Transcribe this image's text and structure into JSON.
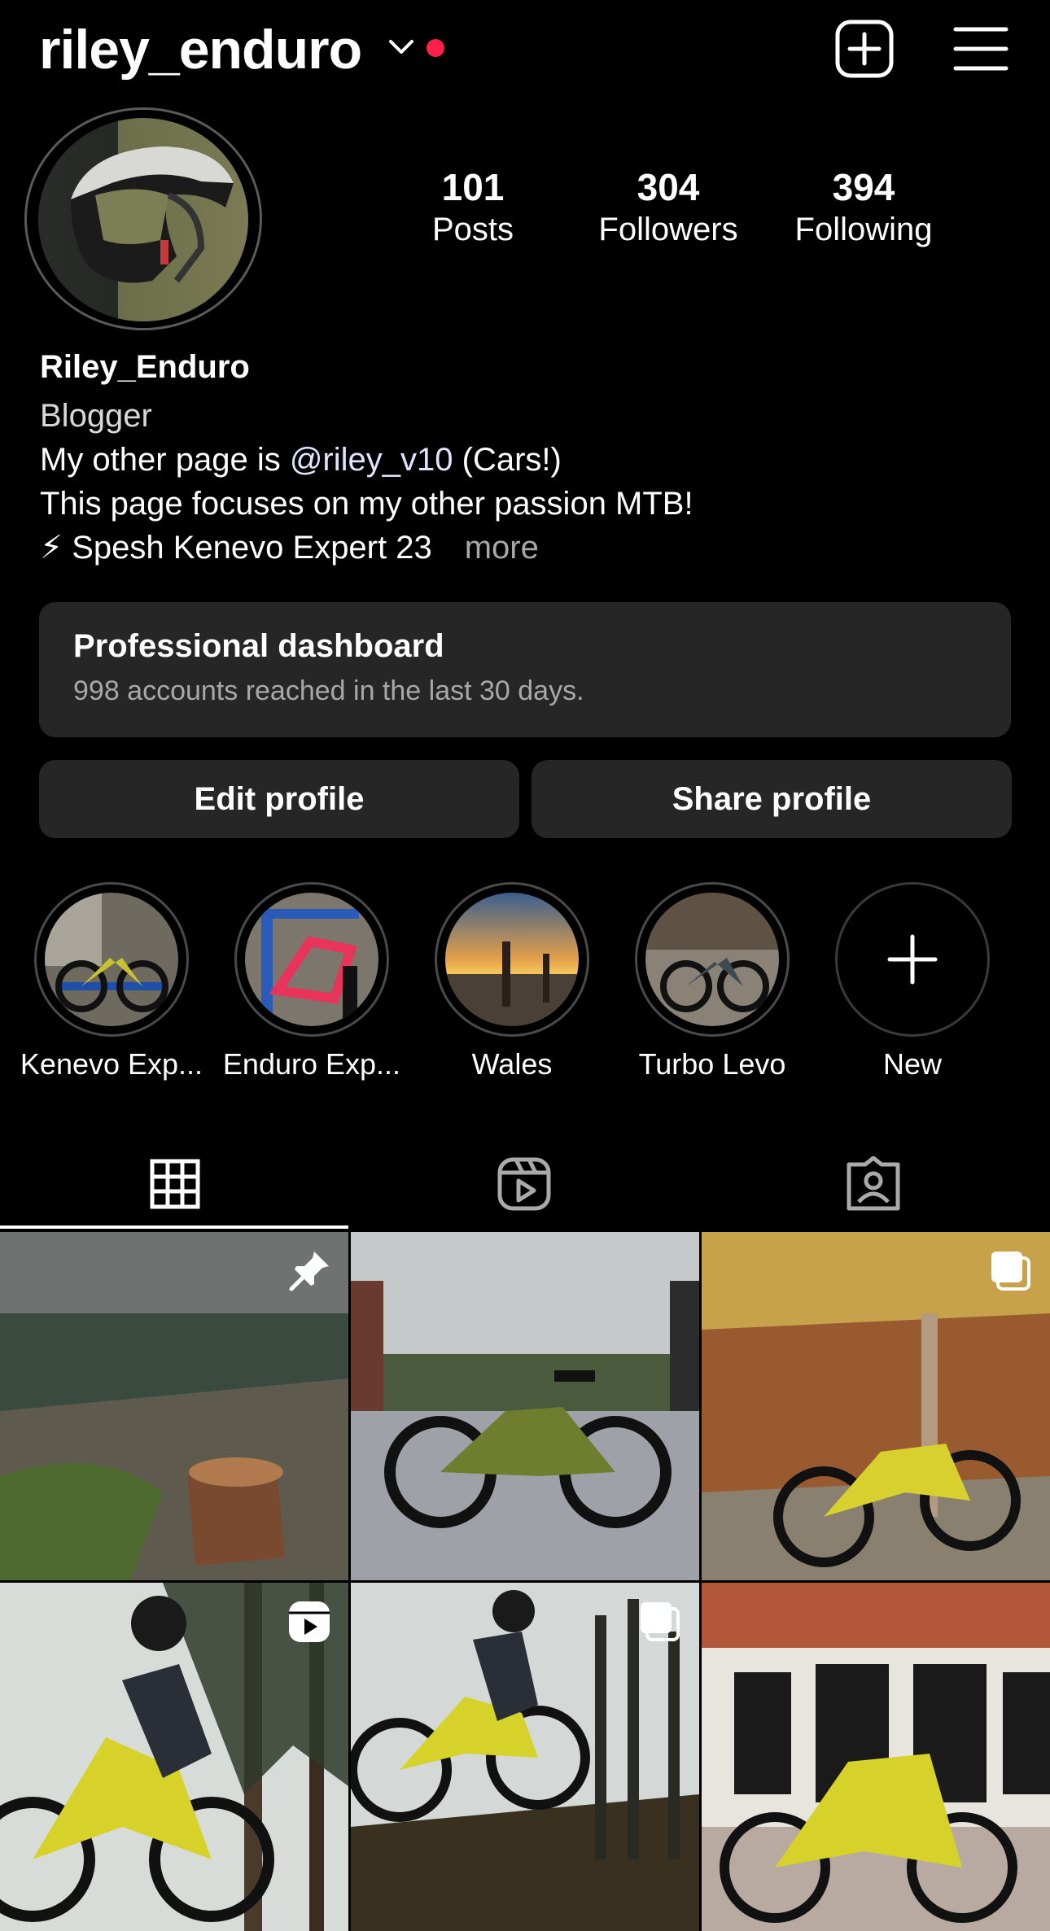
{
  "header": {
    "username": "riley_enduro",
    "icons": [
      "chevron-down-icon",
      "notification-dot",
      "new-post-icon",
      "menu-icon"
    ],
    "accent_color": "#ff1f4b"
  },
  "stats": {
    "posts": {
      "value": "101",
      "label": "Posts"
    },
    "followers": {
      "value": "304",
      "label": "Followers"
    },
    "following": {
      "value": "394",
      "label": "Following"
    }
  },
  "bio": {
    "name": "Riley_Enduro",
    "category": "Blogger",
    "line1_prefix": "My other page is ",
    "line1_mention": "@riley_v10",
    "line1_suffix": " (Cars!)",
    "line2": "This page focuses on my other passion MTB!",
    "line3": "⚡ Spesh Kenevo Expert 23",
    "more": "more"
  },
  "dashboard": {
    "title": "Professional dashboard",
    "subtitle": "998 accounts reached in the last 30 days."
  },
  "actions": {
    "edit": "Edit profile",
    "share": "Share profile"
  },
  "highlights": [
    {
      "label": "Kenevo Exp..."
    },
    {
      "label": "Enduro Exp..."
    },
    {
      "label": "Wales"
    },
    {
      "label": "Turbo Levo"
    },
    {
      "label": "New"
    }
  ],
  "tabs": [
    "grid-icon",
    "reels-icon",
    "tagged-icon"
  ],
  "posts_grid": [
    {
      "badge": "pin-icon"
    },
    {
      "badge": ""
    },
    {
      "badge": "carousel-icon"
    },
    {
      "badge": "reel-icon"
    },
    {
      "badge": "carousel-icon"
    },
    {
      "badge": ""
    }
  ]
}
